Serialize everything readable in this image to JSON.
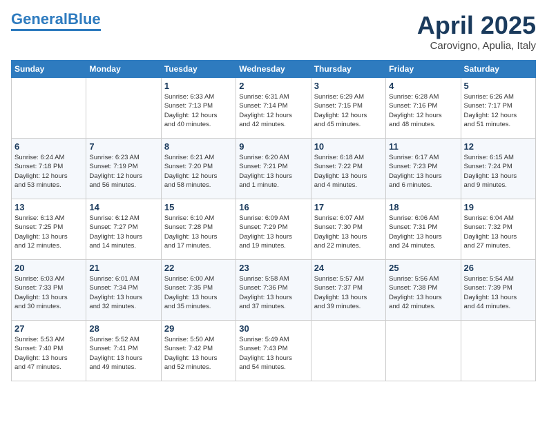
{
  "header": {
    "logo_line1": "General",
    "logo_line2": "Blue",
    "month": "April 2025",
    "location": "Carovigno, Apulia, Italy"
  },
  "days_of_week": [
    "Sunday",
    "Monday",
    "Tuesday",
    "Wednesday",
    "Thursday",
    "Friday",
    "Saturday"
  ],
  "weeks": [
    [
      {
        "day": "",
        "info": ""
      },
      {
        "day": "",
        "info": ""
      },
      {
        "day": "1",
        "info": "Sunrise: 6:33 AM\nSunset: 7:13 PM\nDaylight: 12 hours\nand 40 minutes."
      },
      {
        "day": "2",
        "info": "Sunrise: 6:31 AM\nSunset: 7:14 PM\nDaylight: 12 hours\nand 42 minutes."
      },
      {
        "day": "3",
        "info": "Sunrise: 6:29 AM\nSunset: 7:15 PM\nDaylight: 12 hours\nand 45 minutes."
      },
      {
        "day": "4",
        "info": "Sunrise: 6:28 AM\nSunset: 7:16 PM\nDaylight: 12 hours\nand 48 minutes."
      },
      {
        "day": "5",
        "info": "Sunrise: 6:26 AM\nSunset: 7:17 PM\nDaylight: 12 hours\nand 51 minutes."
      }
    ],
    [
      {
        "day": "6",
        "info": "Sunrise: 6:24 AM\nSunset: 7:18 PM\nDaylight: 12 hours\nand 53 minutes."
      },
      {
        "day": "7",
        "info": "Sunrise: 6:23 AM\nSunset: 7:19 PM\nDaylight: 12 hours\nand 56 minutes."
      },
      {
        "day": "8",
        "info": "Sunrise: 6:21 AM\nSunset: 7:20 PM\nDaylight: 12 hours\nand 58 minutes."
      },
      {
        "day": "9",
        "info": "Sunrise: 6:20 AM\nSunset: 7:21 PM\nDaylight: 13 hours\nand 1 minute."
      },
      {
        "day": "10",
        "info": "Sunrise: 6:18 AM\nSunset: 7:22 PM\nDaylight: 13 hours\nand 4 minutes."
      },
      {
        "day": "11",
        "info": "Sunrise: 6:17 AM\nSunset: 7:23 PM\nDaylight: 13 hours\nand 6 minutes."
      },
      {
        "day": "12",
        "info": "Sunrise: 6:15 AM\nSunset: 7:24 PM\nDaylight: 13 hours\nand 9 minutes."
      }
    ],
    [
      {
        "day": "13",
        "info": "Sunrise: 6:13 AM\nSunset: 7:25 PM\nDaylight: 13 hours\nand 12 minutes."
      },
      {
        "day": "14",
        "info": "Sunrise: 6:12 AM\nSunset: 7:27 PM\nDaylight: 13 hours\nand 14 minutes."
      },
      {
        "day": "15",
        "info": "Sunrise: 6:10 AM\nSunset: 7:28 PM\nDaylight: 13 hours\nand 17 minutes."
      },
      {
        "day": "16",
        "info": "Sunrise: 6:09 AM\nSunset: 7:29 PM\nDaylight: 13 hours\nand 19 minutes."
      },
      {
        "day": "17",
        "info": "Sunrise: 6:07 AM\nSunset: 7:30 PM\nDaylight: 13 hours\nand 22 minutes."
      },
      {
        "day": "18",
        "info": "Sunrise: 6:06 AM\nSunset: 7:31 PM\nDaylight: 13 hours\nand 24 minutes."
      },
      {
        "day": "19",
        "info": "Sunrise: 6:04 AM\nSunset: 7:32 PM\nDaylight: 13 hours\nand 27 minutes."
      }
    ],
    [
      {
        "day": "20",
        "info": "Sunrise: 6:03 AM\nSunset: 7:33 PM\nDaylight: 13 hours\nand 30 minutes."
      },
      {
        "day": "21",
        "info": "Sunrise: 6:01 AM\nSunset: 7:34 PM\nDaylight: 13 hours\nand 32 minutes."
      },
      {
        "day": "22",
        "info": "Sunrise: 6:00 AM\nSunset: 7:35 PM\nDaylight: 13 hours\nand 35 minutes."
      },
      {
        "day": "23",
        "info": "Sunrise: 5:58 AM\nSunset: 7:36 PM\nDaylight: 13 hours\nand 37 minutes."
      },
      {
        "day": "24",
        "info": "Sunrise: 5:57 AM\nSunset: 7:37 PM\nDaylight: 13 hours\nand 39 minutes."
      },
      {
        "day": "25",
        "info": "Sunrise: 5:56 AM\nSunset: 7:38 PM\nDaylight: 13 hours\nand 42 minutes."
      },
      {
        "day": "26",
        "info": "Sunrise: 5:54 AM\nSunset: 7:39 PM\nDaylight: 13 hours\nand 44 minutes."
      }
    ],
    [
      {
        "day": "27",
        "info": "Sunrise: 5:53 AM\nSunset: 7:40 PM\nDaylight: 13 hours\nand 47 minutes."
      },
      {
        "day": "28",
        "info": "Sunrise: 5:52 AM\nSunset: 7:41 PM\nDaylight: 13 hours\nand 49 minutes."
      },
      {
        "day": "29",
        "info": "Sunrise: 5:50 AM\nSunset: 7:42 PM\nDaylight: 13 hours\nand 52 minutes."
      },
      {
        "day": "30",
        "info": "Sunrise: 5:49 AM\nSunset: 7:43 PM\nDaylight: 13 hours\nand 54 minutes."
      },
      {
        "day": "",
        "info": ""
      },
      {
        "day": "",
        "info": ""
      },
      {
        "day": "",
        "info": ""
      }
    ]
  ]
}
